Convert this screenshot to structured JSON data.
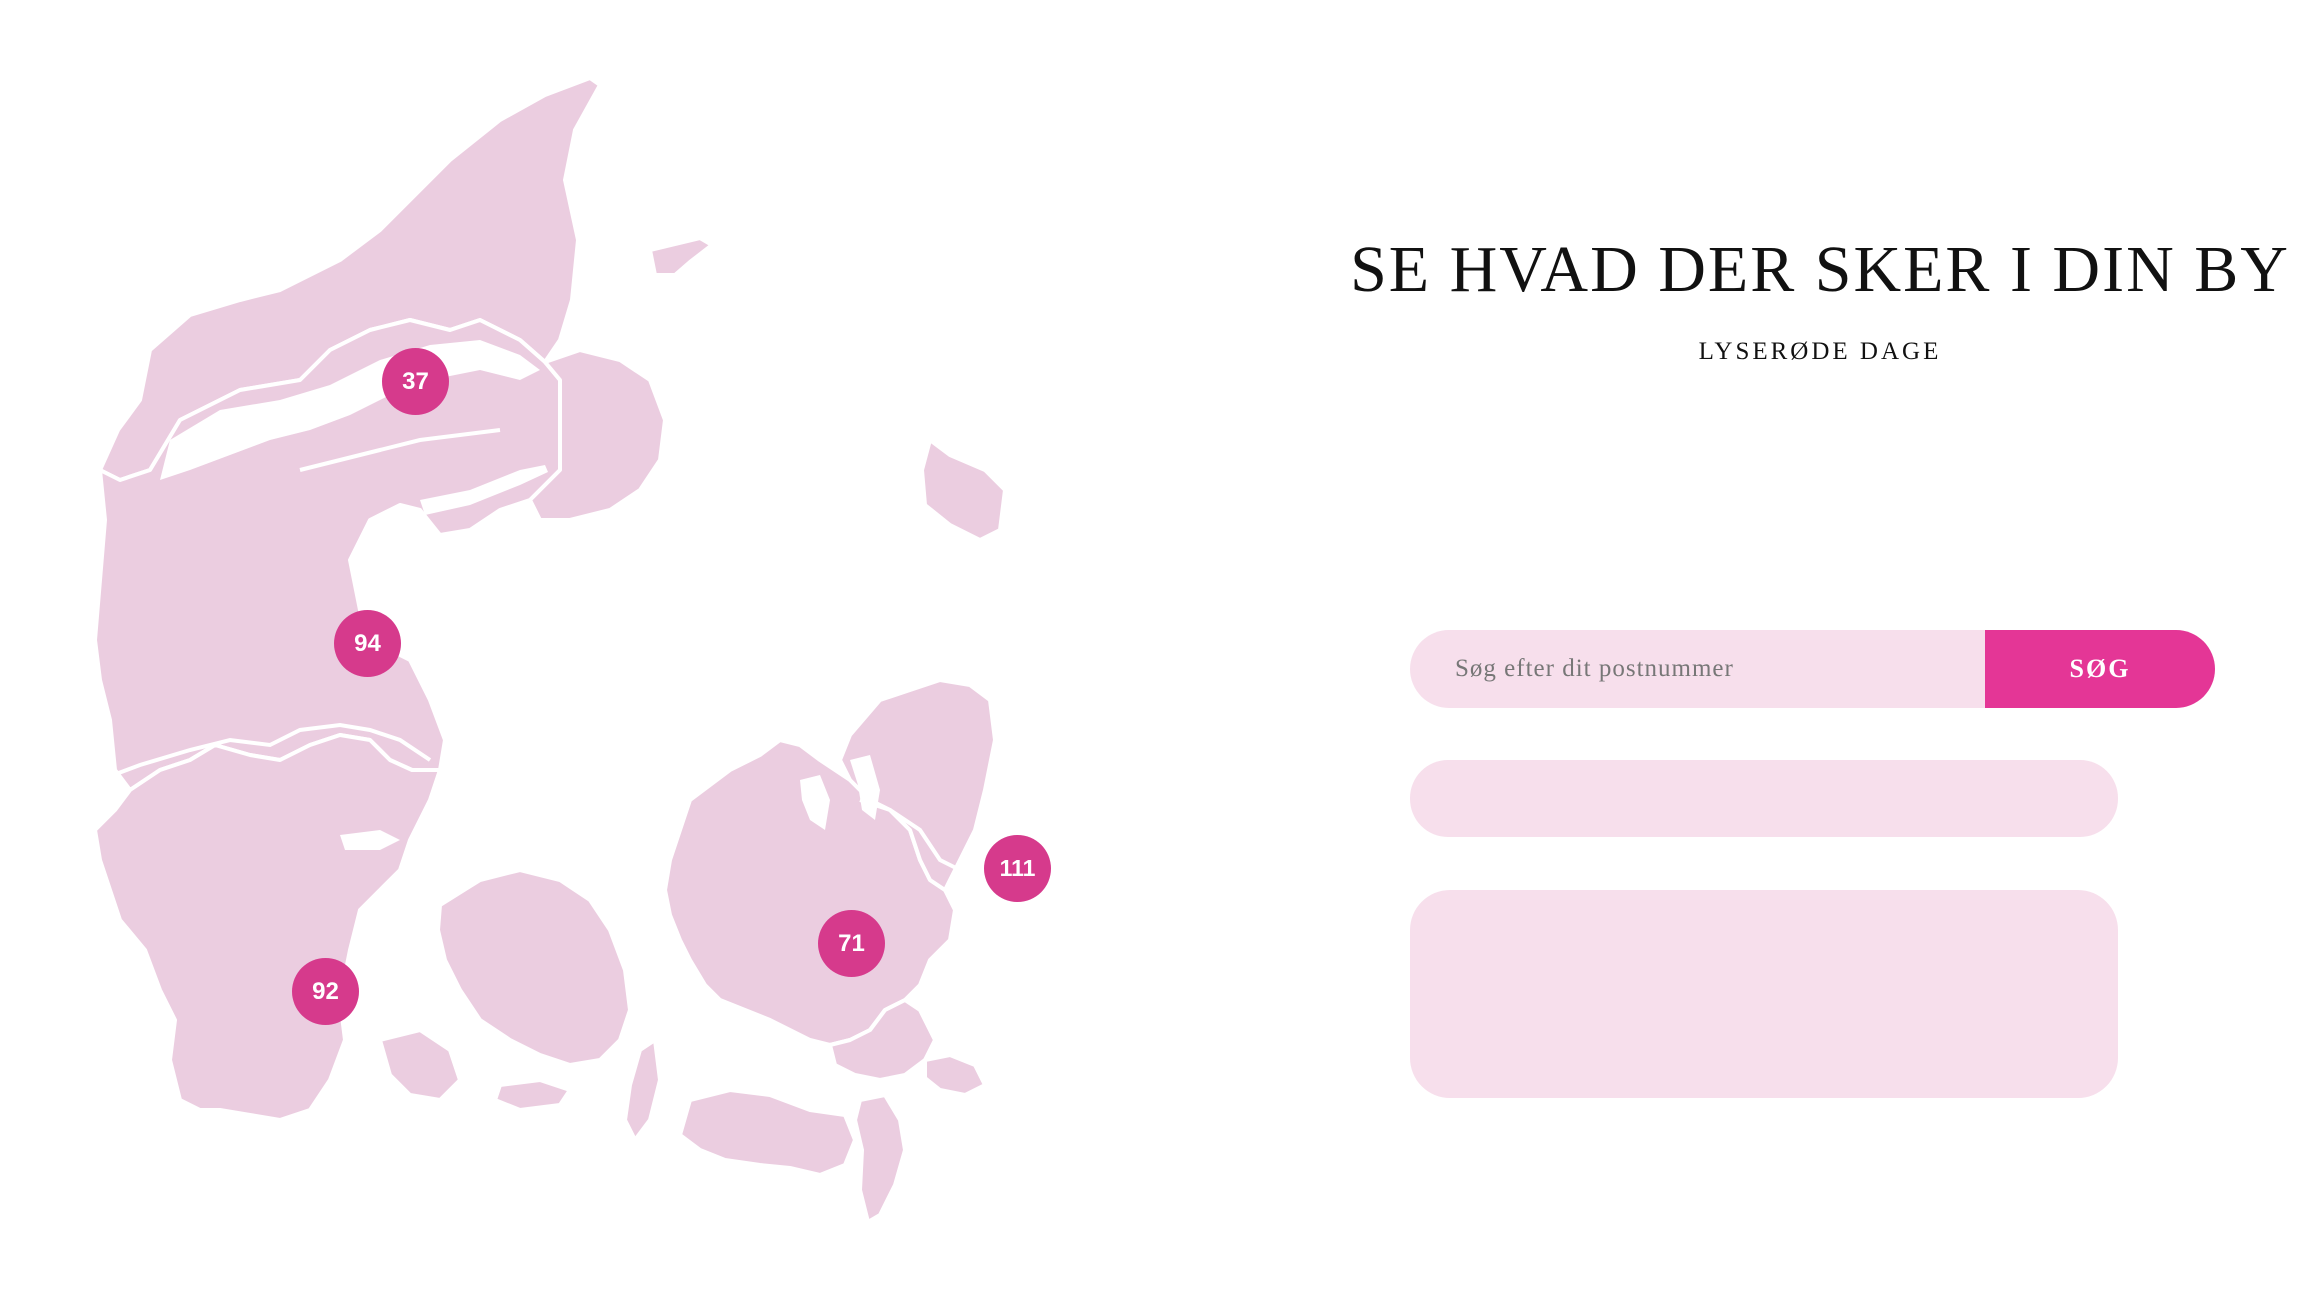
{
  "header": {
    "title": "SE HVAD DER SKER I DIN BY",
    "subtitle": "LYSERØDE DAGE"
  },
  "search": {
    "placeholder": "Søg efter dit postnummer",
    "value": "",
    "button_label": "SØG"
  },
  "map": {
    "region_color": "#ebcde0",
    "marker_color": "#d63a8c",
    "clusters": [
      {
        "id": "nordjylland",
        "count": "37"
      },
      {
        "id": "midtjylland",
        "count": "94"
      },
      {
        "id": "syddanmark",
        "count": "92"
      },
      {
        "id": "sjaelland",
        "count": "71"
      },
      {
        "id": "hovedstaden",
        "count": "111"
      }
    ]
  },
  "colors": {
    "accent": "#e43696",
    "field_background": "#f7dfec",
    "text": "#111111"
  }
}
